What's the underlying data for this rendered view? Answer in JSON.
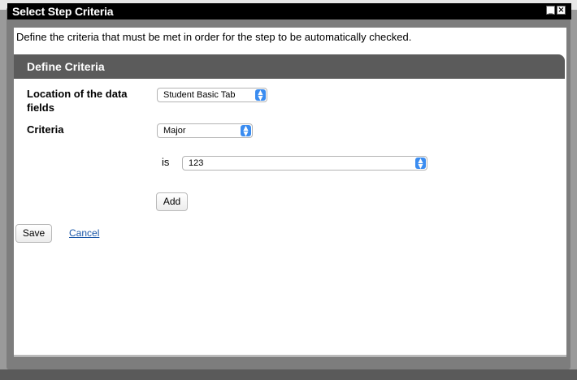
{
  "dialog": {
    "title": "Select Step Criteria",
    "minimize_glyph": "_",
    "close_glyph": "×",
    "intro": "Define the criteria that must be met in order for the step to be automatically checked."
  },
  "section": {
    "header": "Define Criteria"
  },
  "form": {
    "location_label": "Location of the data fields",
    "location_value": "Student Basic Tab",
    "criteria_label": "Criteria",
    "criteria_value": "Major",
    "operator_label": "is",
    "operand_value": "123",
    "add_label": "Add"
  },
  "actions": {
    "save_label": "Save",
    "cancel_label": "Cancel"
  },
  "icons": {
    "select_arrow": "chevron-up-down-icon"
  },
  "colors": {
    "accent": "#3a8cf0",
    "section_header": "#5b5b5b",
    "titlebar": "#000000",
    "link": "#1a57a8"
  }
}
